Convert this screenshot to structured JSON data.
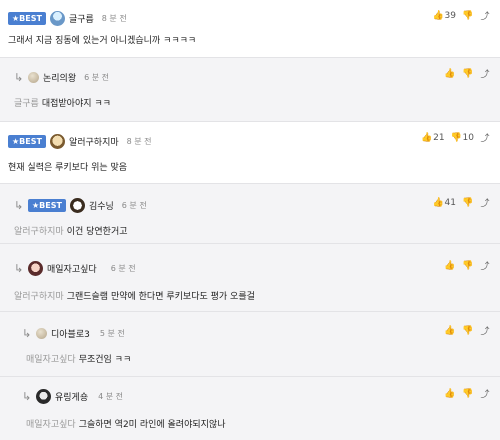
{
  "best_label": "★BEST",
  "icons": {
    "like": "thumbs-up-icon",
    "dislike": "thumbs-down-icon",
    "share": "share-icon",
    "reply_arrow": "reply-arrow-icon"
  },
  "comments": [
    {
      "name": "글구름",
      "time": "8 분 전",
      "mention": "",
      "text": "그래서 지금 징동에 있는거 아니겠습니까 ㅋㅋㅋㅋ",
      "likes": "39",
      "dislikes": "",
      "best": true
    },
    {
      "name": "논리의왕",
      "time": "6 분 전",
      "mention": "글구름",
      "text": "대접받아야지 ㅋㅋ",
      "likes": "",
      "dislikes": "",
      "best": false
    },
    {
      "name": "알러구하지마",
      "time": "8 분 전",
      "mention": "",
      "text": "현재 실력은 루키보다 위는 맞음",
      "likes": "21",
      "dislikes": "10",
      "best": true
    },
    {
      "name": "김수닝",
      "time": "6 분 전",
      "mention": "알러구하지마",
      "text": "이건 당연한거고",
      "likes": "41",
      "dislikes": "",
      "best": true
    },
    {
      "name": "매일자고싶다",
      "time": "6 분 전",
      "mention": "알러구하지마",
      "text": "그랜드슬램 만약에 한다면 루키보다도 평가 오를걸",
      "likes": "",
      "dislikes": "",
      "best": false
    },
    {
      "name": "디아블로3",
      "time": "5 분 전",
      "mention": "매일자고싶다",
      "text": "무조건임 ㅋㅋ",
      "likes": "",
      "dislikes": "",
      "best": false
    },
    {
      "name": "유링게숑",
      "time": "4 분 전",
      "mention": "매일자고싶다",
      "text": "그슬하면 역2미 라인에 올려야되지않나",
      "likes": "",
      "dislikes": "",
      "best": false
    }
  ]
}
